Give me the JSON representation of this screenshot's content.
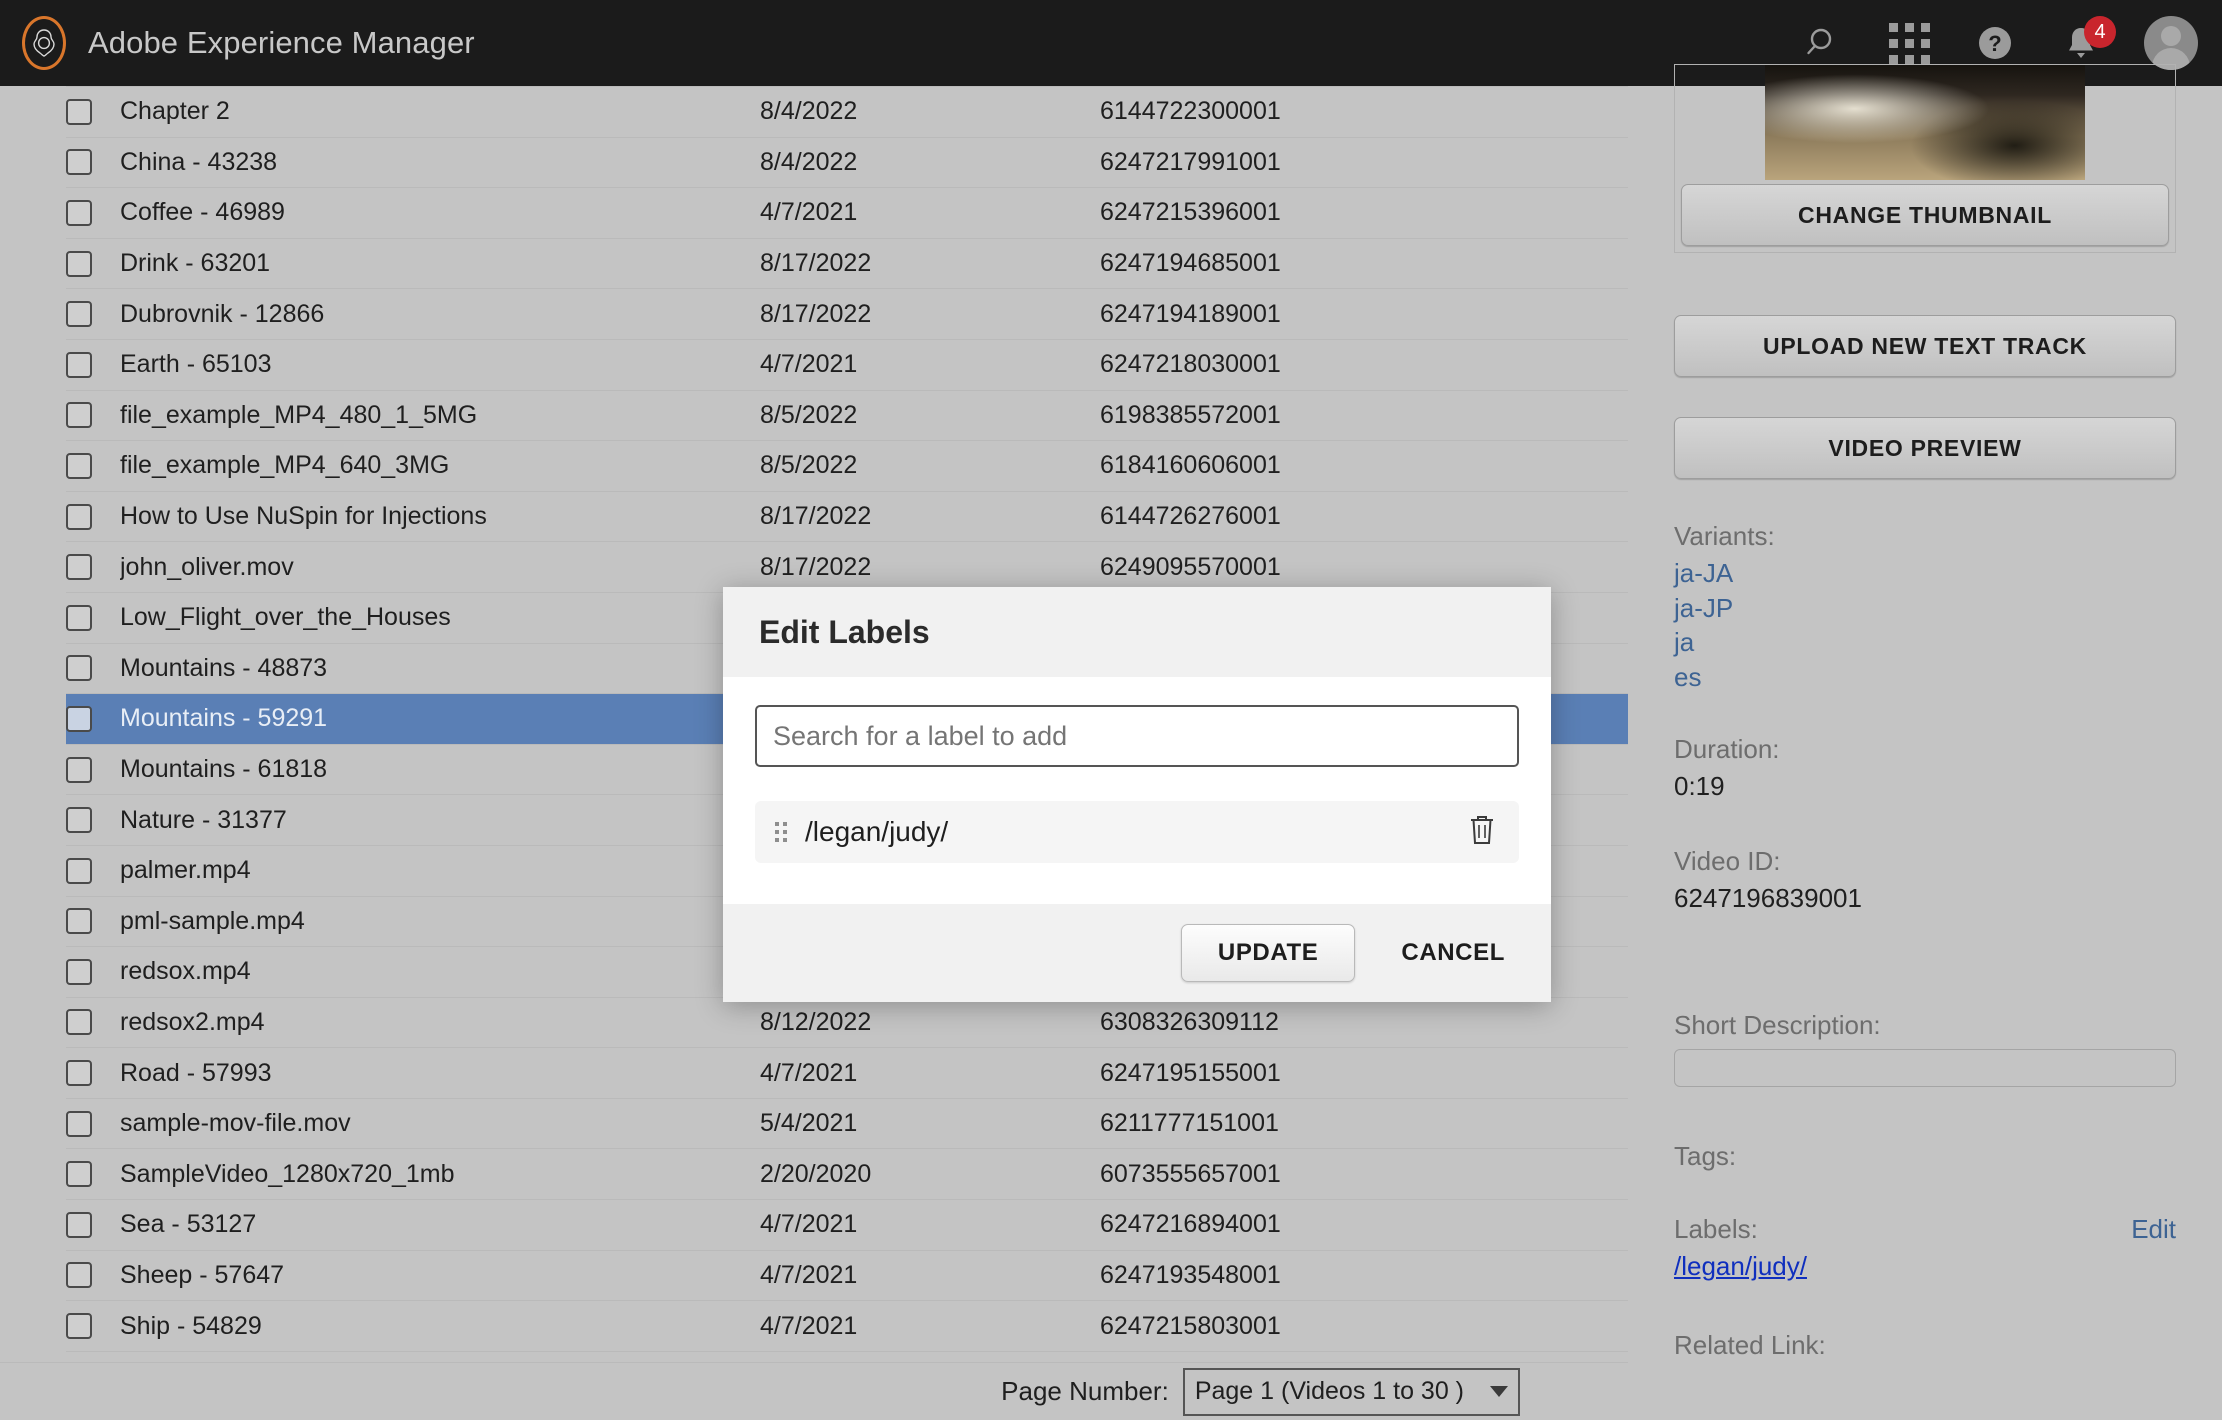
{
  "topbar": {
    "brand_title": "Adobe Experience Manager",
    "logo_name": "adobe-logo",
    "icons": [
      {
        "name": "search-icon"
      },
      {
        "name": "apps-grid-icon"
      },
      {
        "name": "help-icon"
      },
      {
        "name": "notifications-bell-icon",
        "badge": "4"
      },
      {
        "name": "user-avatar"
      }
    ],
    "notification_count": "4"
  },
  "table": {
    "rows": [
      {
        "name": "Chapter 2",
        "date": "8/4/2022",
        "id": "6144722300001"
      },
      {
        "name": "China - 43238",
        "date": "8/4/2022",
        "id": "6247217991001"
      },
      {
        "name": "Coffee - 46989",
        "date": "4/7/2021",
        "id": "6247215396001"
      },
      {
        "name": "Drink - 63201",
        "date": "8/17/2022",
        "id": "6247194685001"
      },
      {
        "name": "Dubrovnik - 12866",
        "date": "8/17/2022",
        "id": "6247194189001"
      },
      {
        "name": "Earth - 65103",
        "date": "4/7/2021",
        "id": "6247218030001"
      },
      {
        "name": "file_example_MP4_480_1_5MG",
        "date": "8/5/2022",
        "id": "6198385572001"
      },
      {
        "name": "file_example_MP4_640_3MG",
        "date": "8/5/2022",
        "id": "6184160606001"
      },
      {
        "name": "How to Use NuSpin for Injections",
        "date": "8/17/2022",
        "id": "6144726276001"
      },
      {
        "name": "john_oliver.mov",
        "date": "8/17/2022",
        "id": "6249095570001"
      },
      {
        "name": "Low_Flight_over_the_Houses",
        "date": "",
        "id": ""
      },
      {
        "name": "Mountains - 48873",
        "date": "",
        "id": ""
      },
      {
        "name": "Mountains - 59291",
        "date": "",
        "id": "",
        "selected": true
      },
      {
        "name": "Mountains - 61818",
        "date": "",
        "id": ""
      },
      {
        "name": "Nature - 31377",
        "date": "",
        "id": ""
      },
      {
        "name": "palmer.mp4",
        "date": "",
        "id": ""
      },
      {
        "name": "pml-sample.mp4",
        "date": "",
        "id": ""
      },
      {
        "name": "redsox.mp4",
        "date": "",
        "id": ""
      },
      {
        "name": "redsox2.mp4",
        "date": "8/12/2022",
        "id": "6308326309112"
      },
      {
        "name": "Road - 57993",
        "date": "4/7/2021",
        "id": "6247195155001"
      },
      {
        "name": "sample-mov-file.mov",
        "date": "5/4/2021",
        "id": "6211777151001"
      },
      {
        "name": "SampleVideo_1280x720_1mb",
        "date": "2/20/2020",
        "id": "6073555657001"
      },
      {
        "name": "Sea - 53127",
        "date": "4/7/2021",
        "id": "6247216894001"
      },
      {
        "name": "Sheep - 57647",
        "date": "4/7/2021",
        "id": "6247193548001"
      },
      {
        "name": "Ship - 54829",
        "date": "4/7/2021",
        "id": "6247215803001"
      }
    ]
  },
  "pagination": {
    "label": "Page Number:",
    "selected_option": "Page 1 (Videos 1 to 30 )"
  },
  "right_panel": {
    "change_thumbnail_label": "CHANGE THUMBNAIL",
    "upload_text_track_label": "UPLOAD NEW TEXT TRACK",
    "video_preview_label": "VIDEO PREVIEW",
    "variants_label": "Variants:",
    "variants": [
      "ja-JA",
      "ja-JP",
      "ja",
      "es"
    ],
    "duration_label": "Duration:",
    "duration_value": "0:19",
    "video_id_label": "Video ID:",
    "video_id_value": "6247196839001",
    "short_description_label": "Short Description:",
    "short_description_value": "",
    "tags_label": "Tags:",
    "labels_label": "Labels:",
    "labels_edit": "Edit",
    "labels_value": "/legan/judy/",
    "related_link_label": "Related Link:"
  },
  "modal": {
    "title": "Edit Labels",
    "search_placeholder": "Search for a label to add",
    "search_value": "",
    "label_item": "/legan/judy/",
    "delete_icon_name": "trash-icon",
    "update_label": "UPDATE",
    "cancel_label": "CANCEL"
  },
  "colors": {
    "topbar_bg": "#1b1b1b",
    "accent_orange": "#d9762b",
    "selection_blue": "#5a7fb5",
    "link_blue": "#3d6393",
    "badge_red": "#c9252d"
  }
}
